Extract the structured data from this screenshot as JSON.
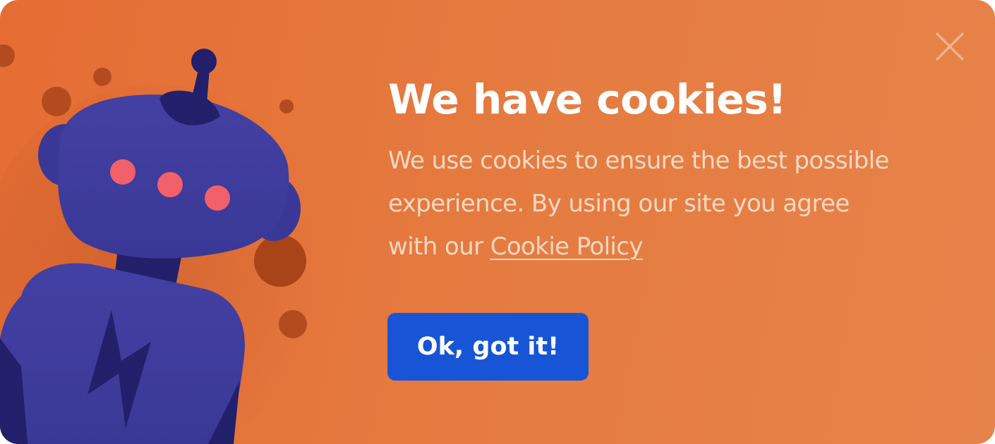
{
  "cookie_banner": {
    "title": "We have cookies!",
    "body_text": "We use cookies to ensure the best possible experience. By using our site you agree with our ",
    "policy_link_label": "Cookie Policy",
    "accept_button_label": "Ok, got it!",
    "close_icon": "close-icon",
    "illustration_icon": "robot-illustration"
  },
  "colors": {
    "background": "#e67a3f",
    "accent_button": "#1755d6",
    "robot_body": "#3f3ea0",
    "robot_dark": "#22206a",
    "robot_eyes": "#f2606a",
    "dots": "#b24a1f"
  }
}
